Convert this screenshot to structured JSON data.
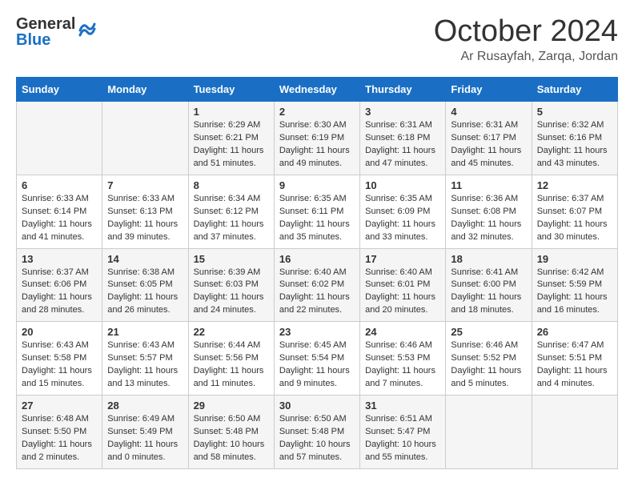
{
  "header": {
    "logo_general": "General",
    "logo_blue": "Blue",
    "month_title": "October 2024",
    "location": "Ar Rusayfah, Zarqa, Jordan"
  },
  "weekdays": [
    "Sunday",
    "Monday",
    "Tuesday",
    "Wednesday",
    "Thursday",
    "Friday",
    "Saturday"
  ],
  "weeks": [
    [
      {
        "day": "",
        "info": ""
      },
      {
        "day": "",
        "info": ""
      },
      {
        "day": "1",
        "info": "Sunrise: 6:29 AM\nSunset: 6:21 PM\nDaylight: 11 hours and 51 minutes."
      },
      {
        "day": "2",
        "info": "Sunrise: 6:30 AM\nSunset: 6:19 PM\nDaylight: 11 hours and 49 minutes."
      },
      {
        "day": "3",
        "info": "Sunrise: 6:31 AM\nSunset: 6:18 PM\nDaylight: 11 hours and 47 minutes."
      },
      {
        "day": "4",
        "info": "Sunrise: 6:31 AM\nSunset: 6:17 PM\nDaylight: 11 hours and 45 minutes."
      },
      {
        "day": "5",
        "info": "Sunrise: 6:32 AM\nSunset: 6:16 PM\nDaylight: 11 hours and 43 minutes."
      }
    ],
    [
      {
        "day": "6",
        "info": "Sunrise: 6:33 AM\nSunset: 6:14 PM\nDaylight: 11 hours and 41 minutes."
      },
      {
        "day": "7",
        "info": "Sunrise: 6:33 AM\nSunset: 6:13 PM\nDaylight: 11 hours and 39 minutes."
      },
      {
        "day": "8",
        "info": "Sunrise: 6:34 AM\nSunset: 6:12 PM\nDaylight: 11 hours and 37 minutes."
      },
      {
        "day": "9",
        "info": "Sunrise: 6:35 AM\nSunset: 6:11 PM\nDaylight: 11 hours and 35 minutes."
      },
      {
        "day": "10",
        "info": "Sunrise: 6:35 AM\nSunset: 6:09 PM\nDaylight: 11 hours and 33 minutes."
      },
      {
        "day": "11",
        "info": "Sunrise: 6:36 AM\nSunset: 6:08 PM\nDaylight: 11 hours and 32 minutes."
      },
      {
        "day": "12",
        "info": "Sunrise: 6:37 AM\nSunset: 6:07 PM\nDaylight: 11 hours and 30 minutes."
      }
    ],
    [
      {
        "day": "13",
        "info": "Sunrise: 6:37 AM\nSunset: 6:06 PM\nDaylight: 11 hours and 28 minutes."
      },
      {
        "day": "14",
        "info": "Sunrise: 6:38 AM\nSunset: 6:05 PM\nDaylight: 11 hours and 26 minutes."
      },
      {
        "day": "15",
        "info": "Sunrise: 6:39 AM\nSunset: 6:03 PM\nDaylight: 11 hours and 24 minutes."
      },
      {
        "day": "16",
        "info": "Sunrise: 6:40 AM\nSunset: 6:02 PM\nDaylight: 11 hours and 22 minutes."
      },
      {
        "day": "17",
        "info": "Sunrise: 6:40 AM\nSunset: 6:01 PM\nDaylight: 11 hours and 20 minutes."
      },
      {
        "day": "18",
        "info": "Sunrise: 6:41 AM\nSunset: 6:00 PM\nDaylight: 11 hours and 18 minutes."
      },
      {
        "day": "19",
        "info": "Sunrise: 6:42 AM\nSunset: 5:59 PM\nDaylight: 11 hours and 16 minutes."
      }
    ],
    [
      {
        "day": "20",
        "info": "Sunrise: 6:43 AM\nSunset: 5:58 PM\nDaylight: 11 hours and 15 minutes."
      },
      {
        "day": "21",
        "info": "Sunrise: 6:43 AM\nSunset: 5:57 PM\nDaylight: 11 hours and 13 minutes."
      },
      {
        "day": "22",
        "info": "Sunrise: 6:44 AM\nSunset: 5:56 PM\nDaylight: 11 hours and 11 minutes."
      },
      {
        "day": "23",
        "info": "Sunrise: 6:45 AM\nSunset: 5:54 PM\nDaylight: 11 hours and 9 minutes."
      },
      {
        "day": "24",
        "info": "Sunrise: 6:46 AM\nSunset: 5:53 PM\nDaylight: 11 hours and 7 minutes."
      },
      {
        "day": "25",
        "info": "Sunrise: 6:46 AM\nSunset: 5:52 PM\nDaylight: 11 hours and 5 minutes."
      },
      {
        "day": "26",
        "info": "Sunrise: 6:47 AM\nSunset: 5:51 PM\nDaylight: 11 hours and 4 minutes."
      }
    ],
    [
      {
        "day": "27",
        "info": "Sunrise: 6:48 AM\nSunset: 5:50 PM\nDaylight: 11 hours and 2 minutes."
      },
      {
        "day": "28",
        "info": "Sunrise: 6:49 AM\nSunset: 5:49 PM\nDaylight: 11 hours and 0 minutes."
      },
      {
        "day": "29",
        "info": "Sunrise: 6:50 AM\nSunset: 5:48 PM\nDaylight: 10 hours and 58 minutes."
      },
      {
        "day": "30",
        "info": "Sunrise: 6:50 AM\nSunset: 5:48 PM\nDaylight: 10 hours and 57 minutes."
      },
      {
        "day": "31",
        "info": "Sunrise: 6:51 AM\nSunset: 5:47 PM\nDaylight: 10 hours and 55 minutes."
      },
      {
        "day": "",
        "info": ""
      },
      {
        "day": "",
        "info": ""
      }
    ]
  ]
}
